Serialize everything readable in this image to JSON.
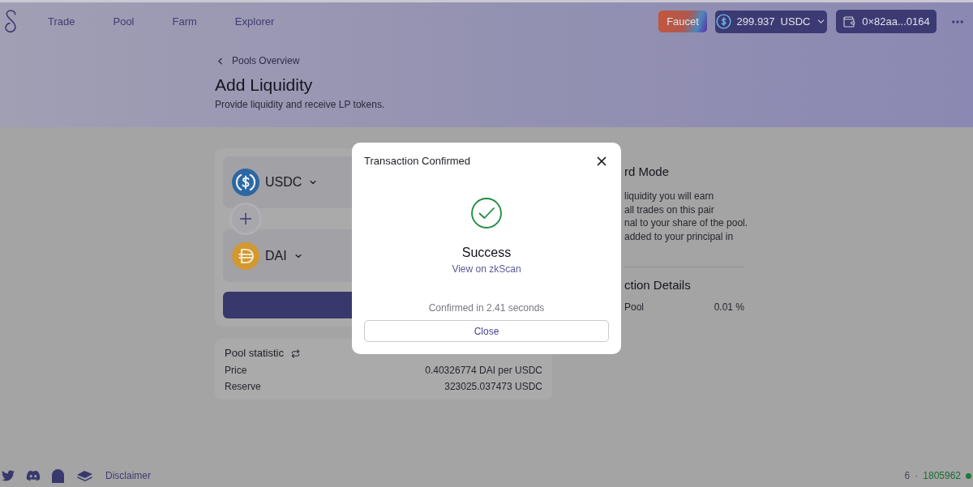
{
  "nav": {
    "items": [
      "Trade",
      "Pool",
      "Farm",
      "Explorer"
    ]
  },
  "header_actions": {
    "faucet": "Faucet",
    "balance": {
      "amount": "299.937",
      "token": "USDC"
    },
    "wallet": "0×82aa...0164"
  },
  "page": {
    "back_link": "Pools Overview",
    "title": "Add Liquidity",
    "subtitle": "Provide liquidity and receive LP tokens."
  },
  "pair": {
    "tokens": [
      {
        "symbol": "USDC"
      },
      {
        "symbol": "DAI"
      }
    ]
  },
  "pool_statistic": {
    "title": "Pool statistic",
    "rows": [
      {
        "label": "Price",
        "value": "0.40326774 DAI per USDC"
      },
      {
        "label": "Reserve",
        "value": "323025.037473 USDC"
      }
    ]
  },
  "info_panel": {
    "mode_title": "rd Mode",
    "mode_lines": [
      "liquidity you will earn",
      "all trades on this pair",
      "nal to your share of the pool.",
      "added to your principal in"
    ],
    "details_title": "ction Details",
    "details_rows": [
      {
        "label": "Pool",
        "value": "0.01 %"
      }
    ]
  },
  "modal": {
    "title": "Transaction Confirmed",
    "status": "Success",
    "link": "View on zkScan",
    "confirmed_text": "Confirmed in 2.41 seconds",
    "close_button": "Close"
  },
  "footer": {
    "disclaimer": "Disclaimer",
    "peers": "6",
    "separator": "·",
    "block": "1805962"
  }
}
